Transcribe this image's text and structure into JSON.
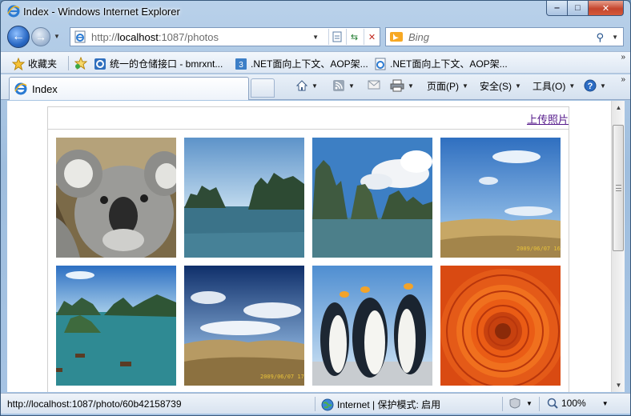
{
  "window": {
    "title": "Index - Windows Internet Explorer",
    "caption": {
      "min": "‒",
      "max": "□",
      "close": "✕"
    }
  },
  "address_bar": {
    "url_prefix": "http://",
    "url_host": "localhost",
    "url_rest": ":1087/photos"
  },
  "search": {
    "placeholder": "Bing"
  },
  "favorites_bar": {
    "favorites_label": "收藏夹",
    "items": [
      {
        "label": "统一的仓储接口 - bmrxnt...",
        "icon": "blog-icon"
      },
      {
        "label": ".NET面向上下文、AOP架...",
        "icon": "document-icon"
      },
      {
        "label": ".NET面向上下文、AOP架...",
        "icon": "ie-page-icon"
      }
    ],
    "more": "»"
  },
  "tab_bar": {
    "active_tab": "Index",
    "commands": {
      "page": "页面(P)",
      "safety": "安全(S)",
      "tools": "工具(O)"
    },
    "more": "»"
  },
  "page": {
    "upload_link": "上传照片",
    "photos": [
      {
        "name": "koala",
        "caption": ""
      },
      {
        "name": "halong-bay-1",
        "caption": ""
      },
      {
        "name": "halong-bay-2",
        "caption": ""
      },
      {
        "name": "desert-1",
        "caption": "2009/06/07  16"
      },
      {
        "name": "halong-bay-boats",
        "caption": ""
      },
      {
        "name": "desert-2",
        "caption": "2009/06/07  17"
      },
      {
        "name": "penguins",
        "caption": ""
      },
      {
        "name": "chrysanthemum",
        "caption": ""
      }
    ]
  },
  "status_bar": {
    "url": "http://localhost:1087/photo/60b42158739",
    "zone": "Internet | 保护模式: 启用",
    "zoom": "100%"
  },
  "colors": {
    "link": "#551a8b",
    "frame": "#a7c4e4",
    "close_button": "#c4452d"
  }
}
